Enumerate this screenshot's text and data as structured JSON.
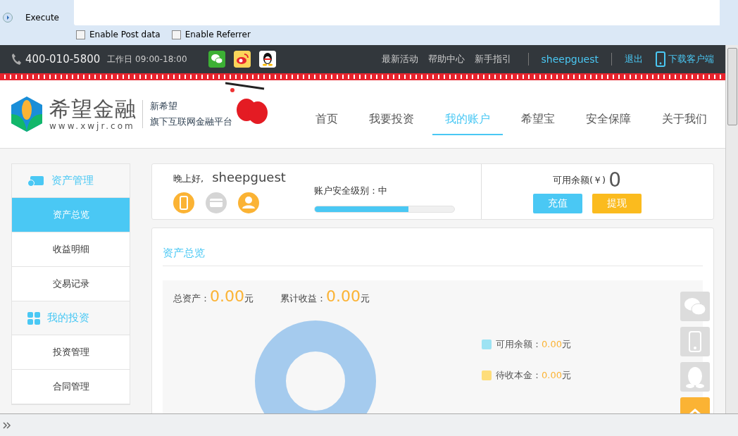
{
  "hackbar": {
    "buttons": [
      {
        "kind": "execute",
        "label": "Execute"
      }
    ],
    "options": [
      {
        "label": "Enable Post data",
        "checked": false
      },
      {
        "label": "Enable Referrer",
        "checked": false
      }
    ]
  },
  "topbar": {
    "phone": "400-010-5800",
    "hours": "工作日 09:00-18:00",
    "links": [
      "最新活动",
      "帮助中心",
      "新手指引"
    ],
    "user": "sheepguest",
    "logout": "退出",
    "download": "下载客户端"
  },
  "header": {
    "logo_text": "希望金融",
    "logo_url": "www.xwjr.com",
    "slogan_1": "新希望",
    "slogan_2": "旗下互联网金融平台",
    "nav": [
      {
        "label": "首页",
        "selected": false
      },
      {
        "label": "我要投资",
        "selected": false
      },
      {
        "label": "我的账户",
        "selected": true
      },
      {
        "label": "希望宝",
        "selected": false
      },
      {
        "label": "安全保障",
        "selected": false
      },
      {
        "label": "关于我们",
        "selected": false
      }
    ]
  },
  "sidebar": {
    "groups": [
      {
        "title": "资产管理",
        "kind": "wallet",
        "items": [
          {
            "label": "资产总览",
            "selected": true
          },
          {
            "label": "收益明细",
            "selected": false
          },
          {
            "label": "交易记录",
            "selected": false
          }
        ]
      },
      {
        "title": "我的投资",
        "kind": "grid",
        "items": [
          {
            "label": "投资管理",
            "selected": false
          },
          {
            "label": "合同管理",
            "selected": false
          }
        ]
      }
    ]
  },
  "account": {
    "greeting": "晚上好,",
    "username": "sheepguest",
    "verifications": [
      {
        "kind": "phone",
        "verified": true
      },
      {
        "kind": "card",
        "verified": false
      },
      {
        "kind": "user",
        "verified": true
      }
    ],
    "security_label": "账户安全级别：中",
    "security": {
      "level": 0.67
    },
    "balance_label": "可用余额(￥)",
    "balance": "0",
    "recharge": "充值",
    "withdraw": "提现"
  },
  "overview": {
    "title": "资产总览",
    "total_label": "总资产：",
    "total": "0.00",
    "total_unit": "元",
    "earn_label": "累计收益：",
    "earn": "0.00",
    "earn_unit": "元",
    "legend": [
      {
        "label": "可用余额：",
        "value": "0.00",
        "unit": "元",
        "color": "#9de3f3"
      },
      {
        "label": "待收本金：",
        "value": "0.00",
        "unit": "元",
        "color": "#fedd7a"
      }
    ]
  }
}
